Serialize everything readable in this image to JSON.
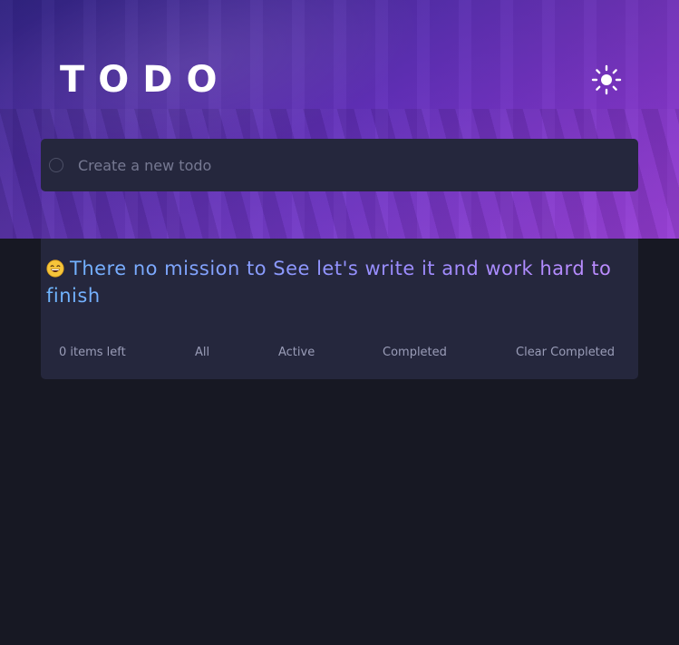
{
  "header": {
    "title": "TODO",
    "theme_icon": "sun-icon"
  },
  "input": {
    "placeholder": "Create a new todo",
    "value": ""
  },
  "list": {
    "empty_emoji": "grinning-face-emoji",
    "empty_message": "There no mission to See let's write it and work hard to finish"
  },
  "footer": {
    "items_left": "0 items left",
    "filter_all": "All",
    "filter_active": "Active",
    "filter_completed": "Completed",
    "clear_completed": "Clear Completed"
  },
  "colors": {
    "background": "#171823",
    "card": "#25273d",
    "accent_start": "#6fb6ff",
    "accent_end": "#c08cff",
    "muted_text": "#9a9db8"
  }
}
